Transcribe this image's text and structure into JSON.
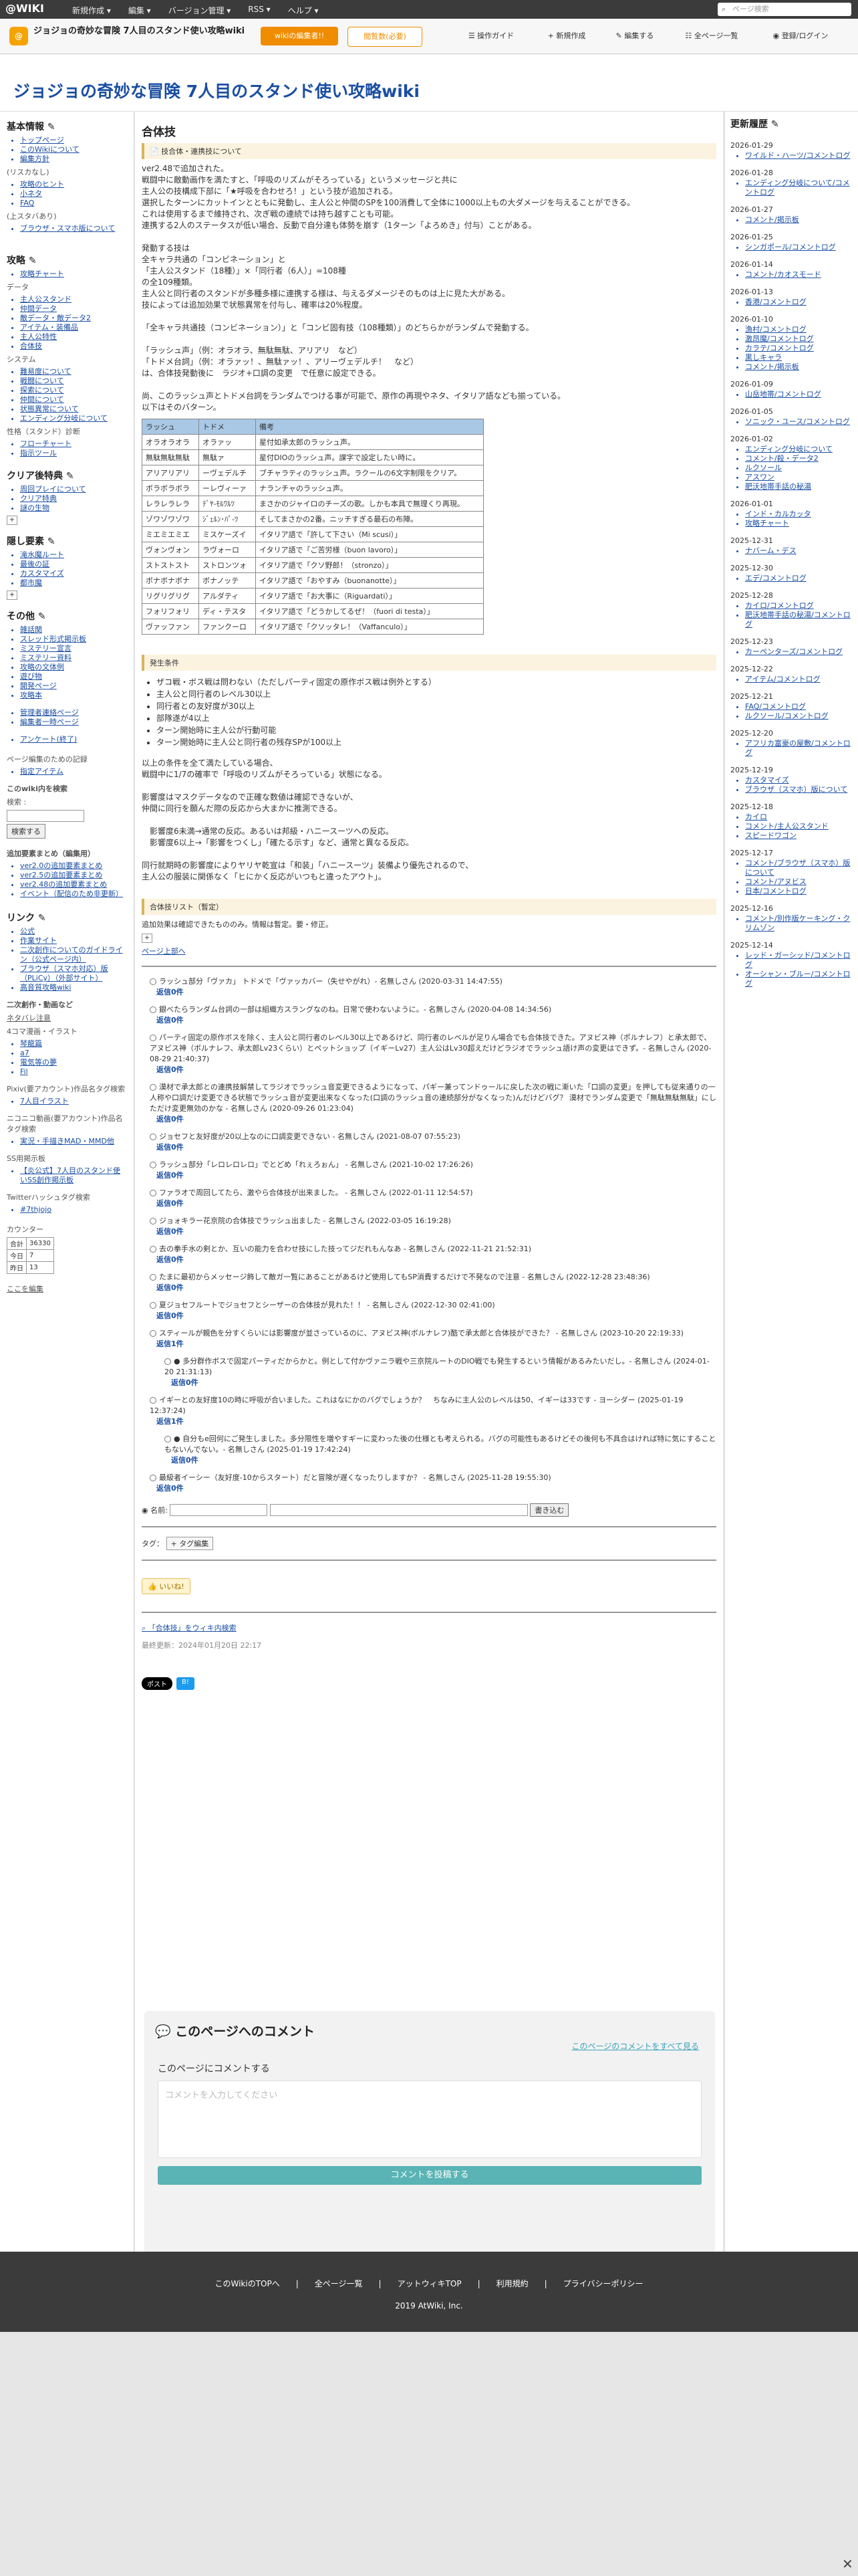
{
  "topbar": {
    "logo": "@WIKI",
    "menu": [
      "新規作成 ▾",
      "編集 ▾",
      "バージョン管理 ▾",
      "RSS ▾",
      "ヘルプ ▾"
    ],
    "search_placeholder": "ページ検索"
  },
  "toolbar": {
    "wiki_name": "ジョジョの奇妙な冒険 7人目のスタンド使い攻略wiki",
    "btn_wiki": "wikiの編集者!!",
    "btn_pay": "閲覧数(必要)",
    "guide": "操作ガイド",
    "new": "新規作成",
    "edit": "編集する",
    "all_pages": "全ページ一覧",
    "login": "登録/ログイン"
  },
  "site_title": "ジョジョの奇妙な冒険 7人目のスタンド使い攻略wiki",
  "left": {
    "basic_title": "基本情報",
    "basic_items": [
      "トップページ",
      "このWikiについて",
      "編集方針"
    ],
    "basic_note": "(リスカなし)",
    "basic_items2": [
      "攻略のヒント",
      "小ネタ",
      "FAQ"
    ],
    "basic_note2": "(上スタバあり)",
    "basic_items3": [
      "ブラウザ・スマホ版について"
    ],
    "strategy_title": "攻略",
    "strategy_items": [
      "攻略チャート"
    ],
    "data_label": "データ",
    "data_items": [
      "主人公スタンド",
      "仲間データ",
      "敵データ・敵データ2",
      "アイテム・装備品",
      "主人公特性",
      "合体技"
    ],
    "system_label": "システム",
    "system_items": [
      "難易度について",
      "戦闘について",
      "探索について",
      "仲間について",
      "状態異常について",
      "エンディング分岐について"
    ],
    "story_label": "性格（スタンド）診断",
    "story_items": [
      "フローチャート",
      "指示ツール"
    ],
    "clear_title": "クリア後特典",
    "clear_items": [
      "周回プレイについて",
      "クリア特典",
      "謎の生物"
    ],
    "hidden_title": "隠し要素",
    "hidden_items": [
      "滝水魔ルート",
      "最後の証",
      "カスタマイズ",
      "都市魔"
    ],
    "other_title": "その他",
    "other_items": [
      "雑話関",
      "スレッド形式掲示板",
      "ミステリー宣言",
      "ミステリー資料",
      "攻略の文体例",
      "遊び物",
      "開発ページ",
      "攻略本"
    ],
    "admin_items": [
      "管理者連絡ページ",
      "編集者一時ページ"
    ],
    "anketo": "アンケート(終了)",
    "page_upd": "ページ編集のための記録",
    "page_upd_items": [
      "指定アイテム"
    ],
    "search_label": "このwiki内を検索",
    "search_sub": "検索 :",
    "search_btn": "検索する",
    "addlist_label": "追加要素まとめ（編集用）",
    "addlist_items": [
      "ver2.0の追加要素まとめ",
      "ver2.5の追加要素まとめ",
      "ver2.48の追加要素まとめ",
      "イベント（配信のため非更新）"
    ],
    "link_title": "リンク",
    "link_items": [
      "公式",
      "作業サイト",
      "二次創作についてのガイドライン（公式ページ内）",
      "ブラウザ（スマホ対応）版（PLiCy）（外部サイト）",
      "高音質攻略wiki"
    ],
    "fan_label": "二次創作・動画など",
    "fan_sub": "ネタバレ注意",
    "fan_note": "4コマ漫画・イラスト",
    "fan_items": [
      "琴龍篇",
      "a7",
      "電気等の夢",
      "Fil"
    ],
    "pixiv_label": "Pixiv(要アカウント)作品名タグ検索",
    "pixiv_items": [
      "7人目イラスト"
    ],
    "nico_label": "ニコニコ動画(要アカウント)作品名タグ検索",
    "nico_items": [
      "実況・手描きMAD・MMD他"
    ],
    "ss_label": "SS用掲示板",
    "ss_items": [
      "【炎公式】7人目のスタンド使いSS創作掲示板"
    ],
    "twitter_label": "Twitterハッシュタグ検索",
    "twitter_items": [
      "#7thjojo"
    ],
    "counter_label": "カウンター",
    "counter": [
      [
        "合計",
        "36330"
      ],
      [
        "今日",
        "7"
      ],
      [
        "昨日",
        "13"
      ]
    ],
    "edit_here": "ここを編集"
  },
  "main": {
    "title": "合体技",
    "note": "技合体・連携技について",
    "intro": "ver2.48で追加された。\n戦闘中に敵動画作を満たすと、「呼吸のリズムがそろっている」というメッセージと共に\n主人公の技構成下部に「★呼吸を合わせろ！」という技が追加される。\n選択したターンにカットインとともに発動し、主人公と仲間のSPを100消費して全体に1000以上もの大ダメージを与えることができる。\nこれは使用するまで維持され、次ぎ戦の連続では持ち越すことも可能。\n連携する2人のステータスが低い場合、反動で自分達も体勢を崩す（1ターン「よろめき」付与）ことがある。\n\n発動する技は\n全キャラ共通の「コンビネーション」と\n「主人公スタンド（18種）」×「同行者（6人）」=108種\nの全109種類。\n主人公と同行者のスタンドが多種多様に連携する様は、与えるダメージそのものは上に見た大がある。\n技によっては追加効果で状態異常を付与し、確率は20%程度。\n\n「全キャラ共通技（コンビネーション）」と「コンビ固有技（108種類）」のどちらかがランダムで発動する。\n\n「ラッシュ声」（例：オラオラ、無駄無駄、アリアリ　など）\n「トドメ台詞」（例：オラァッ！、無駄ァッ！、アリーヴェデルチ！　など）\nは、合体技発動後に　ラジオ+口調の変更　で任意に設定できる。\n\n尚、このラッシュ声とトドメ台詞をランダムでつける事が可能で、原作の再現やネタ、イタリア語なども揃っている。\n以下はそのバターン。",
    "rush_headers": [
      "ラッシュ",
      "トドメ",
      "備考"
    ],
    "rush_rows": [
      [
        "オラオラオラ",
        "オラァッ",
        "星付如承太郎のラッシュ声。"
      ],
      [
        "無駄無駄無駄",
        "無駄ァ",
        "星付DIOのラッシュ声。課字で設定したい時に。"
      ],
      [
        "アリアリアリ",
        "ーヴェデルチ",
        "ブチャラティのラッシュ声。ラクールの6文字制限をクリア。"
      ],
      [
        "ボラボラボラ",
        "ーレヴィーァ",
        "ナランチャのラッシュ声。"
      ],
      [
        "レラレラレラ",
        "ﾃﾞﾔ-ﾓﾙﾜﾙﾂ",
        "まさかのジャイロのチーズの歌。しかも本具で無理くり再現。"
      ],
      [
        "ゾワゾワゾワ",
        "ｼﾞｪﾙﾝ･ﾊﾟ-ﾂ",
        "そしてまさかの2番。ニッチすぎる最石の布陣。"
      ],
      [
        "ミエミエミエ",
        "ミスケーズイ",
        "イタリア語で「許して下さい（Mi scusi）」"
      ],
      [
        "ヴォンヴォン",
        "ラヴォーロ",
        "イタリア語で「ご苦労様（buon lavoro）」"
      ],
      [
        "ストストスト",
        "ストロンツォ",
        "イタリア語で「クソ野郎！（stronzo）」"
      ],
      [
        "ボナボナボナ",
        "ボナノッテ",
        "イタリア語で「おやすみ（buonanotte）」"
      ],
      [
        "リグリグリグ",
        "アルダティ",
        "イタリア語で「お大事に（Riguardati）」"
      ],
      [
        "フォリフォリ",
        "ディ・テスタ",
        "イタリア語で「どうかしてるぜ！（fuori di testa）」"
      ],
      [
        "ヴァッファン",
        "ファンクーロ",
        "イタリア語で「クソッタレ！（Vaffanculo）」"
      ]
    ],
    "cond_title": "発生条件",
    "cond_items": [
      "ザコ戦・ボス戦は問わない（ただしパーティ固定の原作ボス戦は例外とする）",
      "主人公と同行者のレベル30以上",
      "同行者との友好度が30以上",
      "部隊遂が4以上",
      "ターン開始時に主人公が行動可能",
      "ターン開始時に主人公と同行者の残存SPが100以上"
    ],
    "cond_text": "以上の条件を全て満たしている場合、\n戦闘中に1/7の確率で「呼吸のリズムがそろっている」状態になる。\n\n影響度はマスクデータなので正確な数値は確認できないが、\n仲間に同行を願んだ際の反応から大まかに推測できる。\n\n　影響度6未満→通常の反応。あるいは邦級・ハニースーツへの反応。\n　影響度6以上→「影響をつくし」「確たる示す」など、通常と異なる反応。\n\n同行就期時の影響度によりヤリヤ乾宣は「和装」「ハニースーツ」装備より優先されるので、\n主人公の服装に関係なく「ヒにかく反応がいつもと違ったアウト」。",
    "list_note": "合体技リスト（暫定）",
    "list_text": "追加効果は確認できたもののみ。情報は暫定。要・修正。",
    "page_up": "ページ上部へ",
    "comments": [
      {
        "text": "ラッシュ部分「ヴァカ」 トドメで「ヴァッカバー（失せやがれ）- 名無しさん (2020-03-31 14:47:55)",
        "reply": "返信0件"
      },
      {
        "text": "銀べたらランダム台詞の一部は組織方スラングなのね。日常で使わないように。- 名無しさん (2020-04-08 14:34:56)",
        "reply": "返信0件"
      },
      {
        "text": "パーティ固定の原作ボスを除く、主人公と同行者のレベル30以上であるけど、同行者のレベルが足りん場合でも合体技できた。アヌビス神（ポルナレフ）と承太郎で、アヌビス神（ボルナレフ、承太郎Lv23くらい）とペットショップ（イギーLv27）主人公はLv30超えだけどラジオでラッシュ語け声の変更はできず。- 名無しさん (2020-08-29 21:40:37)",
        "reply": "返信0件"
      },
      {
        "text": "漠材で承太郎との連携技解禁してラジオでラッシュ音変更できるようになって、パギー兼ってンドゥールに戻した次の戦に漸いた「口調の変更」を押しても従来通りの一人称や口調だけ変更できる状態でラッシュ音が変更出来なくなった(口調のラッシュ音の連続部分がなくなった)んだけどバグ？ 漠材でランダム変更で「無駄無駄無駄」にしただけ変更無効のかな - 名無しさん (2020-09-26 01:23:04)",
        "reply": "返信0件"
      },
      {
        "text": "ジョセフと友好度が20以上なのに口調変更できない - 名無しさん (2021-08-07 07:55:23)",
        "reply": "返信0件"
      },
      {
        "text": "ラッシュ部分「レロレロレロ」でとどめ「れぇろぉん」 - 名無しさん (2021-10-02 17:26:26)",
        "reply": "返信0件"
      },
      {
        "text": "ファラオで周回してたら、激やら合体技が出来ました。 - 名無しさん (2022-01-11 12:54:57)",
        "reply": "返信0件"
      },
      {
        "text": "ジョォキラー花京院の合体技でラッシュ出ました - 名無しさん (2022-03-05 16:19:28)",
        "reply": "返信0件"
      },
      {
        "text": "去の拳手水の剣とか、互いの能力を合わせ技にした技ってジだれもんなあ - 名無しさん (2022-11-21 21:52:31)",
        "reply": "返信0件"
      },
      {
        "text": "たまに最初からメッセージ飾して敵ガ一覧にあることがあるけど使用してもSP消費するだけで不発なので注意 - 名無しさん (2022-12-28 23:48:36)",
        "reply": "返信0件"
      },
      {
        "text": "夏ジョセフルートでジョセフとシーザーの合体技が見れた！！ - 名無しさん (2022-12-30 02:41:00)",
        "reply": "返信0件"
      },
      {
        "text": "スティールが親色を分すくらいには影響度が並さっているのに、アヌビス神(ボルナレフ)酷で承太郎と合体技ができた？ - 名無しさん (2023-10-20 22:19:33)",
        "reply": "返信1件"
      },
      {
        "text": "イギーとの友好度10の時に呼吸が合いました。これはなにかのバグでしょうか？　ちなみに主人公のレベルは50、イギーは33です - ヨーシダー (2025-01-19 12:37:24)",
        "reply": "返信1件"
      },
      {
        "text": "最級者イーシー（友好度-10からスタート）だと冒険が遅くなったりしますか？ - 名無しさん (2025-11-28 19:55:30)",
        "reply": "返信0件"
      }
    ],
    "replies": [
      {
        "after": 11,
        "text": "多分群作ボスで固定パーティだからかと。例として付かヴァニラ戦や三京院ルートのDIO戦でも発生するという情報があるみたいだし。- 名無しさん (2024-01-20 21:31:13)",
        "reply": "返信0件"
      },
      {
        "after": 12,
        "text": "自分もe回何にご発生しました。多分限性を増やすギーに変わった後の仕様とも考えられる。バグの可能性もあるけどその後何も不具合はければ特に気にすることもないんでない。- 名無しさん (2025-01-19 17:42:24)",
        "reply": "返信0件"
      }
    ],
    "name_label": "名前:",
    "submit_label": "書き込む",
    "tag_label": "タグ：",
    "tag_btn": "タグ編集",
    "like": "いいね!",
    "wikisearch": "「合体技」をウィキ内検索",
    "lastupd": "最終更新：2024年01月20日 22:17",
    "share_x": "ポスト",
    "share_b": "B!",
    "comment_box_title": "このページへのコメント",
    "comment_all": "このページのコメントをすべて見る",
    "comment_sub": "このページにコメントする",
    "comment_placeholder": "コメントを入力してください",
    "comment_post": "コメントを投稿する"
  },
  "right": {
    "title": "更新履歴",
    "days": [
      {
        "date": "2026-01-29",
        "items": [
          "ワイルド・ハーツ/コメントログ"
        ]
      },
      {
        "date": "2026-01-28",
        "items": [
          "エンディング分岐について/コメントログ"
        ]
      },
      {
        "date": "2026-01-27",
        "items": [
          "コメント/掲示板"
        ]
      },
      {
        "date": "2026-01-25",
        "items": [
          "シンガポール/コメントログ"
        ]
      },
      {
        "date": "2026-01-14",
        "items": [
          "コメント/カオスモード"
        ]
      },
      {
        "date": "2026-01-13",
        "items": [
          "香港/コメントログ"
        ]
      },
      {
        "date": "2026-01-10",
        "items": [
          "漁村/コメントログ",
          "激昂魔/コメントログ",
          "カラテ/コメントログ",
          "黒しキャラ",
          "コメント/掲示板"
        ]
      },
      {
        "date": "2026-01-09",
        "items": [
          "山岳地帯/コメントログ"
        ]
      },
      {
        "date": "2026-01-05",
        "items": [
          "ソニック・ユース/コメントログ"
        ]
      },
      {
        "date": "2026-01-02",
        "items": [
          "エンディング分岐について",
          "コメント/殺・データ2",
          "ルクソール",
          "アスワン",
          "肥沃地帯手話の秘湯"
        ]
      },
      {
        "date": "2026-01-01",
        "items": [
          "インド・カルカッタ",
          "攻略チャート"
        ]
      },
      {
        "date": "2025-12-31",
        "items": [
          "ナバーム・デス"
        ]
      },
      {
        "date": "2025-12-30",
        "items": [
          "エデ/コメントログ"
        ]
      },
      {
        "date": "2025-12-28",
        "items": [
          "カイロ/コメントログ",
          "肥沃地帯手話の秘湯/コメントログ"
        ]
      },
      {
        "date": "2025-12-23",
        "items": [
          "カーペンターズ/コメントログ"
        ]
      },
      {
        "date": "2025-12-22",
        "items": [
          "アイテム/コメントログ"
        ]
      },
      {
        "date": "2025-12-21",
        "items": [
          "FAQ/コメントログ",
          "ルクソール/コメントログ"
        ]
      },
      {
        "date": "2025-12-20",
        "items": [
          "アフリカ富豪の屋敷/コメントログ"
        ]
      },
      {
        "date": "2025-12-19",
        "items": [
          "カスタマイズ",
          "ブラウザ（スマホ）版について"
        ]
      },
      {
        "date": "2025-12-18",
        "items": [
          "カイロ",
          "コメント/主人公スタンド",
          "スピードワゴン"
        ]
      },
      {
        "date": "2025-12-17",
        "items": [
          "コメント/ブラウザ（スマホ）版について",
          "コメント/アヌビス",
          "日本/コメントログ"
        ]
      },
      {
        "date": "2025-12-16",
        "items": [
          "コメント/別作版ケーキング・クリムゾン"
        ]
      },
      {
        "date": "2025-12-14",
        "items": [
          "レッド・ガーシッド/コメントログ",
          "オーシャン・ブルー/コメントログ"
        ]
      }
    ]
  },
  "footer": {
    "links": [
      "このWikiのTOPへ",
      "全ページ一覧",
      "アットウィキTOP",
      "利用規約",
      "プライバシーポリシー"
    ],
    "copy": "2019 AtWiki, Inc."
  }
}
